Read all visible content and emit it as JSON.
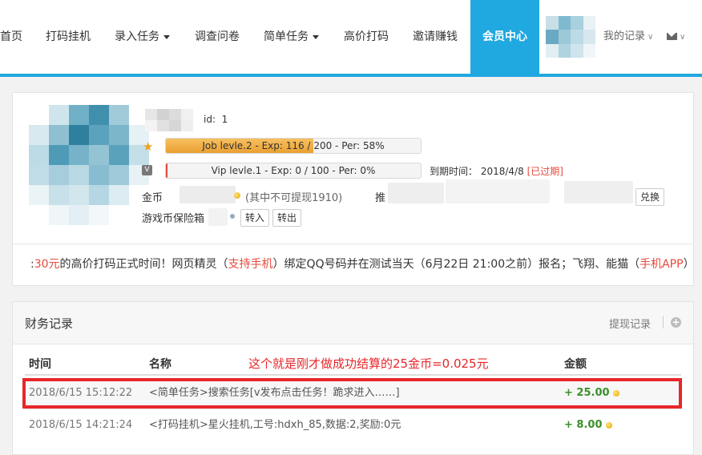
{
  "nav": {
    "items": [
      {
        "label": "首页",
        "caret": false
      },
      {
        "label": "打码挂机",
        "caret": false
      },
      {
        "label": "录入任务",
        "caret": true
      },
      {
        "label": "调查问卷",
        "caret": false
      },
      {
        "label": "简单任务",
        "caret": true
      },
      {
        "label": "高价打码",
        "caret": false
      },
      {
        "label": "邀请赚钱",
        "caret": false
      }
    ],
    "active": "会员中心",
    "my_records": "我的记录",
    "accent": "#20a8e0"
  },
  "profile": {
    "uid_label": "id:",
    "uid_value": "1",
    "job_bar": "Job levle.2 - Exp: 116 / 200 - Per: 58%",
    "job_percent": 58,
    "vip_bar": "Vip levle.1 - Exp: 0 / 100 - Per: 0%",
    "vip_percent": 0,
    "expire_label": "到期时间：",
    "expire_date": "2018/4/8",
    "expired_tag": "[已过期]",
    "coin_label": "金币",
    "coin_note": "(其中不可提现1910)",
    "promo_label": "推",
    "exchange_btn": "兑换",
    "safe_label": "游戏币保险箱",
    "deposit_btn": "转入",
    "withdraw_btn": "转出"
  },
  "notice": {
    "parts": [
      {
        "text": ":",
        "red": false
      },
      {
        "text": "30元",
        "red": true
      },
      {
        "text": "的高价打码正式时间！网页精灵（",
        "red": false
      },
      {
        "text": "支持手机",
        "red": true
      },
      {
        "text": "）绑定QQ号码并在测试当天（6月22日 21:00之前）报名；飞翔、能猫（",
        "red": false
      },
      {
        "text": "手机APP",
        "red": true
      },
      {
        "text": "）",
        "red": false
      }
    ]
  },
  "finance": {
    "title": "财务记录",
    "withdraw_link": "提现记录",
    "headers": {
      "time": "时间",
      "name": "名称",
      "amount": "金额"
    },
    "annotation": "这个就是刚才做成功结算的25金币=0.025元",
    "rows": [
      {
        "time": "2018/6/15 15:12:22",
        "name": "<简单任务>搜索任务[v发布点击任务！跪求进入……]",
        "amount": "+ 25.00",
        "highlight": true
      },
      {
        "time": "2018/6/15 14:21:24",
        "name": "<打码挂机>星火挂机,工号:hdxh_85,数据:2,奖励:0元",
        "amount": "+ 8.00",
        "highlight": false
      }
    ]
  }
}
